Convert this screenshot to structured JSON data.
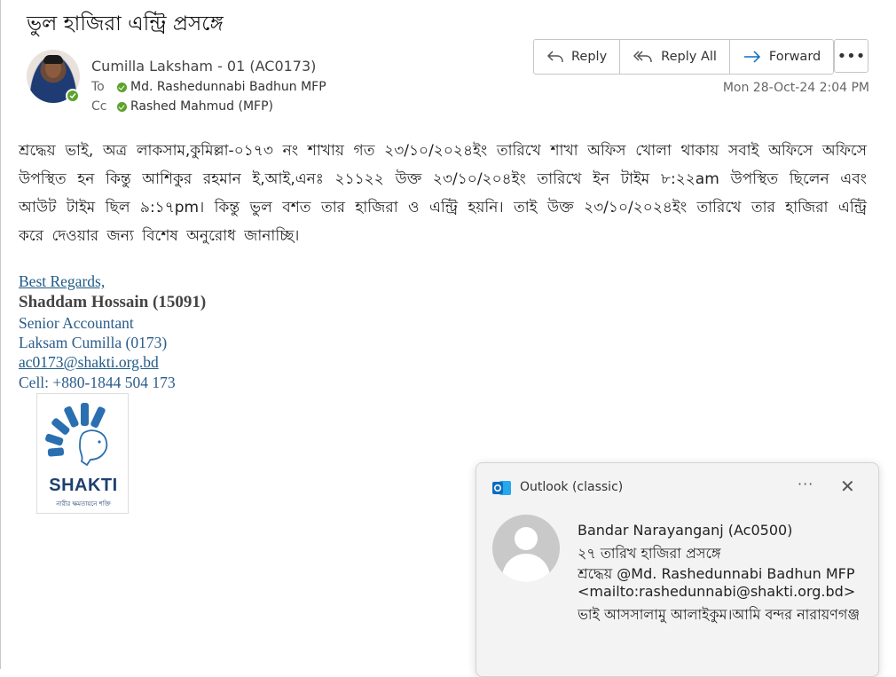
{
  "email": {
    "subject": "ভুল হাজিরা এন্ট্রি প্রসঙ্গে",
    "sender": "Cumilla Laksham - 01 (AC0173)",
    "to_label": "To",
    "to": "Md. Rashedunnabi Badhun MFP",
    "cc_label": "Cc",
    "cc": "Rashed Mahmud (MFP)",
    "date": "Mon 28-Oct-24 2:04 PM",
    "body": "শ্রদ্ধেয় ভাই, অত্র লাকসাম,কুমিল্লা-০১৭৩ নং শাখায় গত ২৩/১০/২০২৪ইং তারিখে শাখা অফিস খোলা থাকায় সবাই অফিসে অফিসে উপস্থিত হন কিন্তু আশিকুর রহমান ই,আই,এনঃ ২১১২২ উক্ত ২৩/১০/২০৪ইং তারিখে ইন টাইম ৮:২২am উপস্থিত ছিলেন এবং আউট টাইম ছিল ৯:১৭pm। কিন্তু ভুল বশত তার হাজিরা ও এন্ট্রি হয়নি। তাই উক্ত ২৩/১০/২০২৪ইং তারিখে তার হাজিরা এন্ট্রি করে দেওয়ার জন্য বিশেষ অনুরোধ জানাচ্ছি।"
  },
  "actions": {
    "reply": "Reply",
    "reply_all": "Reply All",
    "forward": "Forward",
    "more": "•••"
  },
  "signature": {
    "greeting": "Best Regards,",
    "name": "Shaddam Hossain (15091)",
    "title": "Senior Accountant",
    "office": "Laksam Cumilla (0173)",
    "email": "ac0173@shakti.org.bd",
    "cell": "Cell: +880-1844 504 173",
    "logo_text": "SHAKTI",
    "logo_tagline": "নারীর ক্ষমতায়নে শক্তি"
  },
  "toast": {
    "app": "Outlook (classic)",
    "sender": "Bandar Narayanganj (Ac0500)",
    "subject": "২৭ তারিখ হাজিরা প্রসঙ্গে",
    "line1": "শ্রদ্ধেয় @Md. Rashedunnabi Badhun MFP",
    "line2": "<mailto:rashedunnabi@shakti.org.bd>",
    "line3": "ভাই আসসালামু আলাইকুম।আমি বন্দর নারায়ণগঞ্জ",
    "more": "···",
    "close": "✕"
  },
  "colors": {
    "presence_green": "#5ca32b",
    "signature_blue": "#2a5c8a",
    "outlook_blue": "#0f6cbd"
  }
}
